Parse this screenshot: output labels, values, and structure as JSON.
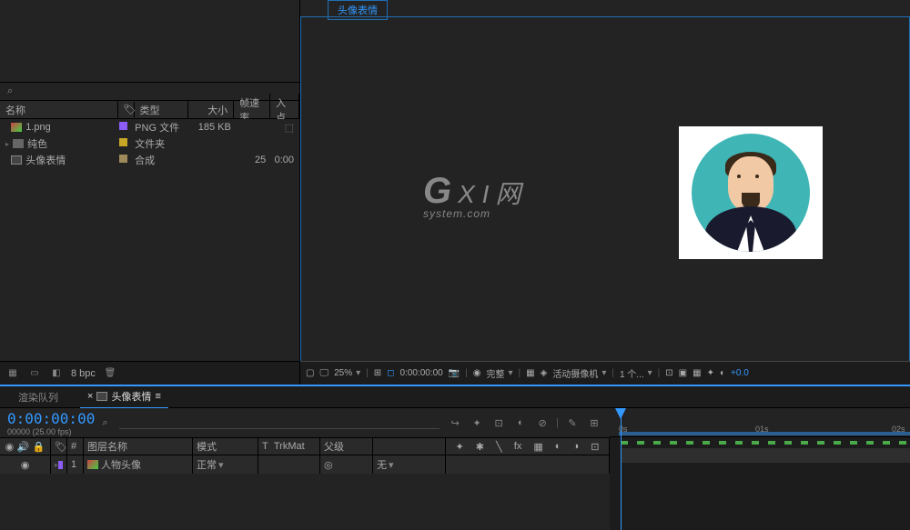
{
  "project": {
    "search_placeholder": "",
    "columns": {
      "name": "名称",
      "type": "类型",
      "size": "大小",
      "fps": "帧速率",
      "in": "入点"
    },
    "items": [
      {
        "name": "1.png",
        "tag_color": "#8b5cf6",
        "type": "PNG 文件",
        "size": "185 KB",
        "fps": "",
        "in": "",
        "icon": "image"
      },
      {
        "name": "纯色",
        "tag_color": "#c9a726",
        "type": "文件夹",
        "size": "",
        "fps": "",
        "in": "",
        "icon": "folder"
      },
      {
        "name": "头像表情",
        "tag_color": "#9e8a5a",
        "type": "合成",
        "size": "",
        "fps": "25",
        "in": "0:00",
        "icon": "comp"
      }
    ],
    "bpc": "8 bpc"
  },
  "preview": {
    "tab": "头像表情",
    "watermark_main": "G X I 网",
    "watermark_sub": "system.com",
    "footer": {
      "zoom": "25%",
      "time": "0:00:00:00",
      "quality": "完整",
      "camera": "活动摄像机",
      "views": "1 个...",
      "exposure": "+0.0"
    }
  },
  "timeline": {
    "tabs": {
      "render": "渲染队列",
      "comp": "头像表情"
    },
    "timecode": "0:00:00:00",
    "timecode_sub": "00000 (25.00 fps)",
    "columns": {
      "layer_name": "图层名称",
      "mode": "模式",
      "trkmat": "TrkMat",
      "parent": "父级",
      "t": "T"
    },
    "layer": {
      "num": "1",
      "name": "人物头像",
      "mode": "正常",
      "parent": "无"
    },
    "ruler": {
      "t0": "0s",
      "t1": "01s",
      "t2": "02s"
    }
  }
}
